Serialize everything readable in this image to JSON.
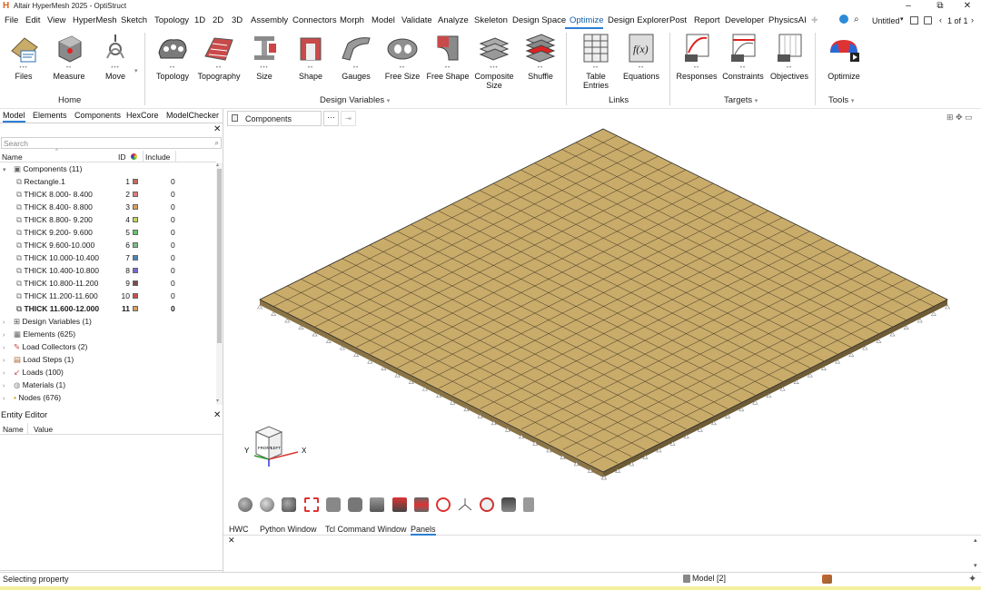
{
  "window": {
    "title": "Altair HyperMesh 2025 - OptiStruct",
    "logo": "H",
    "minimize": "–",
    "maximize": "⧉",
    "close": "✕"
  },
  "menu": [
    "File",
    "Edit",
    "View",
    "HyperMesh",
    "Sketch",
    "Topology",
    "1D",
    "2D",
    "3D",
    "Assembly",
    "Connectors",
    "Morph",
    "Model",
    "Validate",
    "Analyze",
    "Skeleton",
    "Design Space",
    "Optimize",
    "Design Explorer",
    "Post",
    "Report",
    "Developer",
    "PhysicsAI"
  ],
  "menu_active": "Optimize",
  "toolbar_right": {
    "session": "Untitled",
    "page": "1 of 1"
  },
  "ribbon": {
    "buttons": {
      "files": "Files",
      "measure": "Measure",
      "move": "Move",
      "topology": "Topology",
      "topography": "Topography",
      "size": "Size",
      "shape": "Shape",
      "gauges": "Gauges",
      "free_size": "Free Size",
      "free_shape": "Free Shape",
      "composite_size": "Composite Size",
      "shuffle": "Shuffle",
      "table_entries": "Table Entries",
      "equations": "Equations",
      "responses": "Responses",
      "constraints": "Constraints",
      "objectives": "Objectives",
      "optimize": "Optimize"
    },
    "groups": {
      "home": "Home",
      "design_variables": "Design Variables",
      "links": "Links",
      "targets": "Targets",
      "tools": "Tools"
    }
  },
  "left_tabs": [
    "Model",
    "Elements",
    "Components",
    "HexCore",
    "ModelChecker"
  ],
  "search": {
    "placeholder": "Search"
  },
  "tree_columns": {
    "name": "Name",
    "id": "ID",
    "include": "Include"
  },
  "tree": {
    "components_root": "Components (11)",
    "components": [
      {
        "name": "Rectangle.1",
        "id": "1",
        "color": "#c76a5a",
        "include": "0"
      },
      {
        "name": "THICK  8.000- 8.400",
        "id": "2",
        "color": "#d98080",
        "include": "0"
      },
      {
        "name": "THICK  8.400- 8.800",
        "id": "3",
        "color": "#d9a05a",
        "include": "0"
      },
      {
        "name": "THICK  8.800- 9.200",
        "id": "4",
        "color": "#c6d35a",
        "include": "0"
      },
      {
        "name": "THICK  9.200- 9.600",
        "id": "5",
        "color": "#6ac46a",
        "include": "0"
      },
      {
        "name": "THICK  9.600-10.000",
        "id": "6",
        "color": "#7dbd8e",
        "include": "0"
      },
      {
        "name": "THICK 10.000-10.400",
        "id": "7",
        "color": "#4a86b8",
        "include": "0"
      },
      {
        "name": "THICK 10.400-10.800",
        "id": "8",
        "color": "#7a6ad0",
        "include": "0"
      },
      {
        "name": "THICK 10.800-11.200",
        "id": "9",
        "color": "#7a4a4a",
        "include": "0"
      },
      {
        "name": "THICK 11.200-11.600",
        "id": "10",
        "color": "#c85050",
        "include": "0"
      },
      {
        "name": "THICK 11.600-12.000",
        "id": "11",
        "color": "#d6a060",
        "include": "0"
      }
    ],
    "others": [
      "Design Variables (1)",
      "Elements (625)",
      "Load Collectors (2)",
      "Load Steps (1)",
      "Loads (100)",
      "Materials (1)",
      "Nodes (676)"
    ]
  },
  "entity_editor": {
    "title": "Entity Editor",
    "name_col": "Name",
    "value_col": "Value"
  },
  "viewport": {
    "tab": "Components",
    "more": "···",
    "plate_color": "#c9ab6a",
    "mesh": 25,
    "axis_x": "X",
    "axis_y": "Y",
    "cube_front": "FRONT",
    "cube_left": "LEFT"
  },
  "bottom_tabs": [
    "HWC",
    "Python Window",
    "Tcl Command Window",
    "Panels"
  ],
  "bottom_active": "Panels",
  "status": {
    "text": "Selecting property",
    "model": "Model [2]"
  }
}
